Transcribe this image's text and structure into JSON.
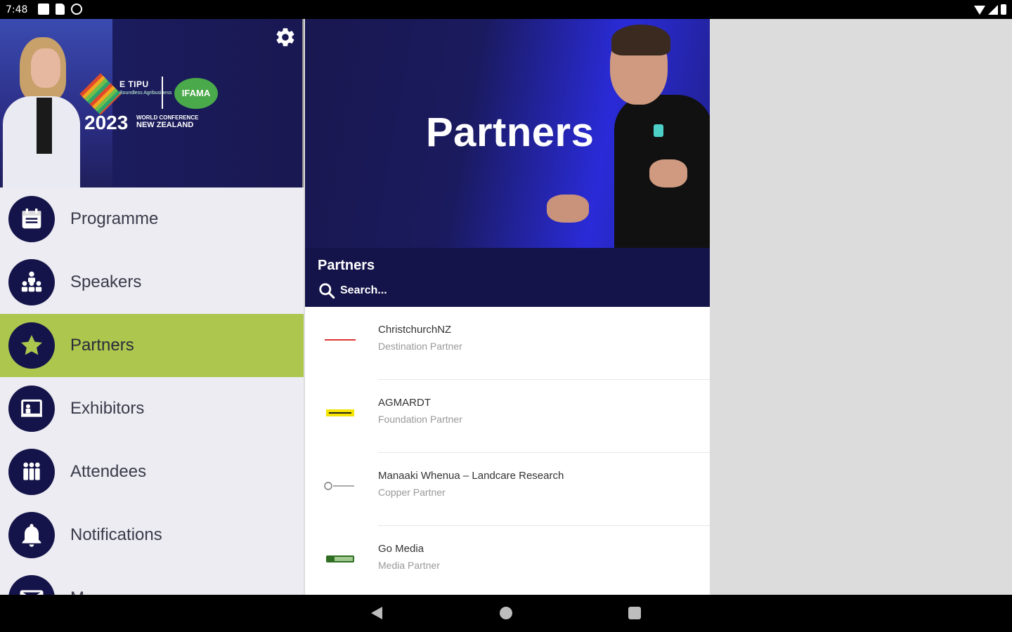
{
  "status_bar": {
    "time": "7:48"
  },
  "drawer": {
    "header": {
      "logo_brand": "E TIPU",
      "logo_brand_sub": "Boundless Agribusiness",
      "logo_partner": "IFAMA",
      "logo_year": "2023",
      "logo_conf_line1": "WORLD CONFERENCE",
      "logo_conf_line2": "NEW ZEALAND"
    },
    "items": [
      {
        "label": "Programme",
        "icon": "calendar-icon"
      },
      {
        "label": "Speakers",
        "icon": "speakers-icon"
      },
      {
        "label": "Partners",
        "icon": "star-icon",
        "active": true
      },
      {
        "label": "Exhibitors",
        "icon": "exhibitor-icon"
      },
      {
        "label": "Attendees",
        "icon": "attendees-icon"
      },
      {
        "label": "Notifications",
        "icon": "bell-icon"
      },
      {
        "label": "M",
        "icon": "mail-icon"
      }
    ]
  },
  "hero": {
    "title": "Partners"
  },
  "list_header": {
    "title": "Partners",
    "search_placeholder": "Search..."
  },
  "partners": [
    {
      "name": "ChristchurchNZ",
      "role": "Destination Partner",
      "logo_color": "#d33"
    },
    {
      "name": "AGMARDT",
      "role": "Foundation Partner",
      "logo_color": "#f5e400"
    },
    {
      "name": "Manaaki Whenua – Landcare Research",
      "role": "Copper Partner",
      "logo_color": "#888"
    },
    {
      "name": "Go Media",
      "role": "Media Partner",
      "logo_color": "#3a7d2a"
    }
  ],
  "colors": {
    "navy": "#15144a",
    "active": "#acc64e"
  }
}
